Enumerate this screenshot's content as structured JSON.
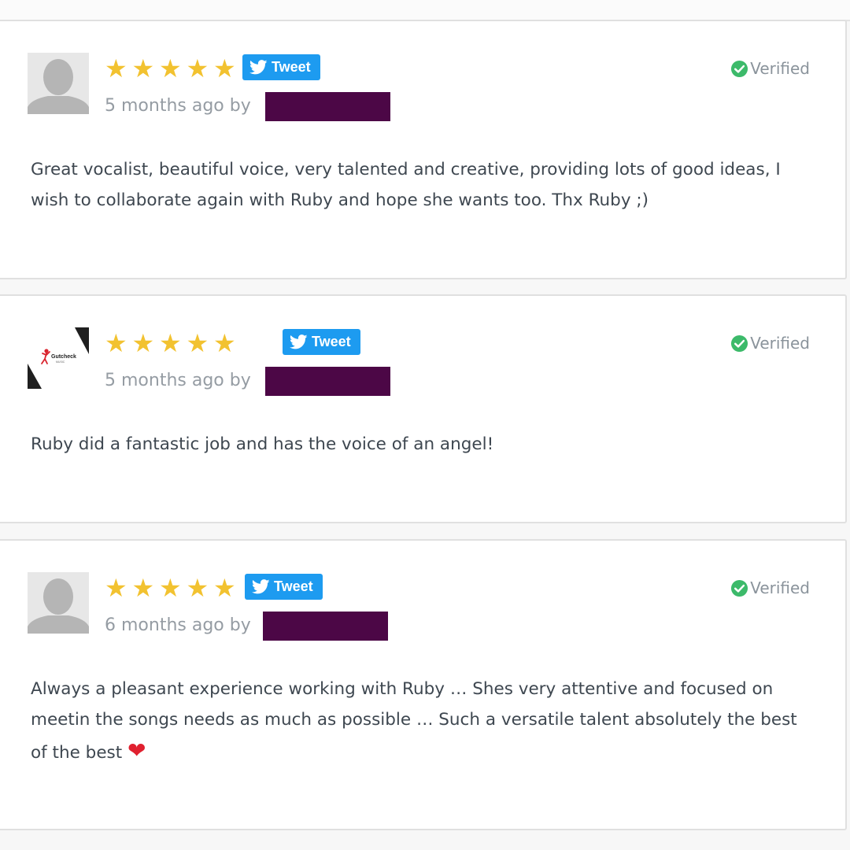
{
  "colors": {
    "star": "#f2c230",
    "tweet_button": "#1d9bf0",
    "verified_check": "#3cba6a",
    "redaction": "#4c0746",
    "meta_text": "#959ca3",
    "body_text": "#3e4750"
  },
  "reviews": [
    {
      "avatar": "default-user-silhouette",
      "rating": 5,
      "star_glyph": "★",
      "tweet_label": "Tweet",
      "time_ago": "5 months ago by",
      "verified_label": "Verified",
      "text": "Great vocalist, beautiful voice, very talented and creative, providing lots of good ideas, I wish to collaborate again with Ruby and hope she wants too. Thx Ruby ;)"
    },
    {
      "avatar": "gutcheck-music-logo",
      "avatar_logo_text": "Gutcheck",
      "avatar_logo_subtext": "MUSIC",
      "rating": 5,
      "star_glyph": "★",
      "tweet_label": "Tweet",
      "time_ago": "5 months ago by",
      "verified_label": "Verified",
      "text": "Ruby did a fantastic job and has the voice of an angel!"
    },
    {
      "avatar": "default-user-silhouette",
      "rating": 5,
      "star_glyph": "★",
      "tweet_label": "Tweet",
      "time_ago": "6 months ago by",
      "verified_label": "Verified",
      "text": "Always a pleasant experience working with Ruby … Shes very attentive and focused on meetin the songs needs as much as possible … Such a versatile talent absolutely the best of the best",
      "emoji": "❤"
    }
  ]
}
